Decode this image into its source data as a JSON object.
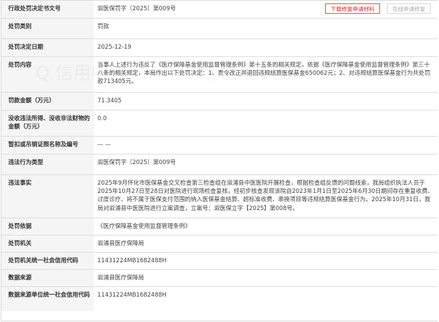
{
  "rows": [
    {
      "label": "行政处罚决定书文号",
      "value": "溆医保罚字〔2025〕第009号"
    },
    {
      "label": "处罚类别",
      "value": "罚款"
    },
    {
      "label": "处罚决定日期",
      "value": "2025-12-19"
    },
    {
      "label": "处罚内容",
      "value": "当事人上述行为违反了《医疗保障基金使用监督管理条例》第十五条的相关规定，依据《医疗保障基金使用监督管理条例》第三十八条的相关规定，本局作出以下处罚决定：1、责令改正并退回违规结算医保基金650062元；2、对违规结算医保基金行为共处罚款713405元。"
    },
    {
      "label": "罚款金额（万元）",
      "value": "71.3405"
    },
    {
      "label": "没收违法所得、没收非法财物的金额（万元）",
      "value": "0.0"
    },
    {
      "label": "暂扣或吊销证照名称及编号",
      "value": "— —"
    },
    {
      "label": "违法行为类型",
      "value": "溆医保罚字〔2025〕第009号"
    },
    {
      "label": "违法事实",
      "value": "2025年9月怀化市医保基金交叉检查第三检查组在溆浦县中医医院开展检查，根据检查组反馈的问题线索，我局组织执法人员于2025年10月27日至28日对医院进行现场检查复核，经初步核查发现该院自2023年1月1日至2025年6月30日期间存在重复收费、过度诊疗、将不属于医保支付范围的纳入医保基金结算、超标准收费、串换项目等违规结算医保基金行为。2025年10月31日，我局对溆浦县中医医院进行立案调查，立案号：溆医保立字【2025】第008号。"
    },
    {
      "label": "处罚依据",
      "value": "《医疗保障基金使用监督管理条例》"
    },
    {
      "label": "处罚机关",
      "value": "溆浦县医疗保障局"
    },
    {
      "label": "处罚机关统一社会信用代码",
      "value": "11431224MB1682488H"
    },
    {
      "label": "数据来源",
      "value": "溆浦县医疗保障局"
    },
    {
      "label": "数据来源单位统一社会信用代码",
      "value": "11431224MB1682488H"
    }
  ],
  "actions": {
    "download_label": "下载修复申请材料",
    "online_label": "在线申请修复"
  },
  "watermark_text": "Q 信用中国",
  "colors": {
    "label_bg": "#f5f5f5",
    "border": "#dcdcdc",
    "accent_red": "#d12b2b"
  }
}
